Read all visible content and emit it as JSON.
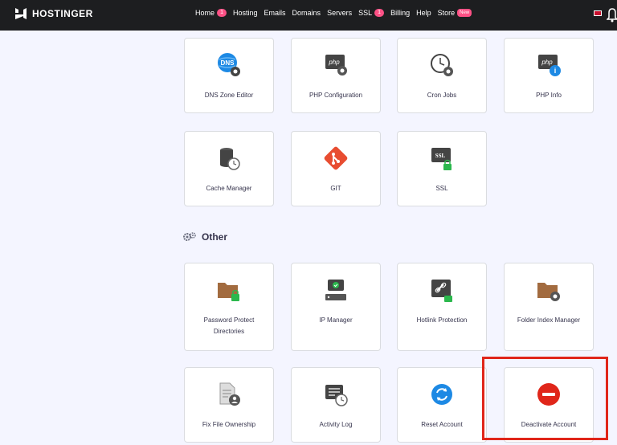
{
  "brand": {
    "name": "HOSTINGER"
  },
  "nav": [
    {
      "label": "Home",
      "badge": "1"
    },
    {
      "label": "Hosting"
    },
    {
      "label": "Emails"
    },
    {
      "label": "Domains"
    },
    {
      "label": "Servers"
    },
    {
      "label": "SSL",
      "badge": "1"
    },
    {
      "label": "Billing"
    },
    {
      "label": "Help"
    },
    {
      "label": "Store",
      "badge": "New"
    }
  ],
  "advanced_cards": [
    {
      "label": "DNS Zone Editor",
      "icon": "dns-gear-icon"
    },
    {
      "label": "PHP Configuration",
      "icon": "php-gear-icon"
    },
    {
      "label": "Cron Jobs",
      "icon": "clock-gear-icon"
    },
    {
      "label": "PHP Info",
      "icon": "php-info-icon"
    },
    {
      "label": "Cache Manager",
      "icon": "database-clock-icon"
    },
    {
      "label": "GIT",
      "icon": "git-icon"
    },
    {
      "label": "SSL",
      "icon": "ssl-lock-icon"
    }
  ],
  "other_section": {
    "title": "Other",
    "cards": [
      {
        "label": "Password Protect Directories",
        "icon": "folder-lock-icon"
      },
      {
        "label": "IP Manager",
        "icon": "ip-server-icon"
      },
      {
        "label": "Hotlink Protection",
        "icon": "link-lock-icon"
      },
      {
        "label": "Folder Index Manager",
        "icon": "folder-gear-icon"
      },
      {
        "label": "Fix File Ownership",
        "icon": "file-user-icon"
      },
      {
        "label": "Activity Log",
        "icon": "log-clock-icon"
      },
      {
        "label": "Reset Account",
        "icon": "reset-icon"
      },
      {
        "label": "Deactivate Account",
        "icon": "deactivate-icon"
      }
    ]
  },
  "colors": {
    "accent": "#673de6",
    "danger": "#fc5185",
    "highlight": "#e0261a",
    "topbar": "#1d1e20"
  }
}
